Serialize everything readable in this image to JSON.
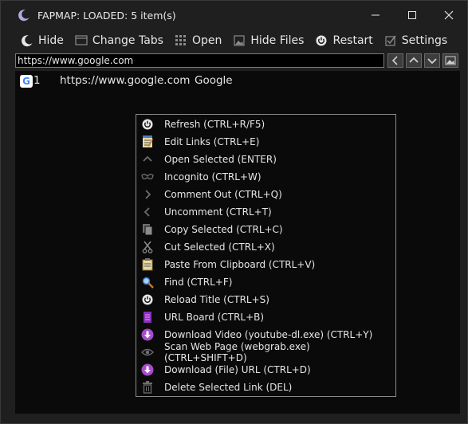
{
  "window": {
    "title": "FAPMAP: LOADED: 5 item(s)",
    "icon": "moon-icon",
    "controls": [
      "minimize-icon",
      "maximize-icon",
      "close-icon"
    ]
  },
  "menu": [
    {
      "label": "Hide",
      "icon": "moon-icon"
    },
    {
      "label": "Change Tabs",
      "icon": "window-icon"
    },
    {
      "label": "Open",
      "icon": "grid-icon"
    },
    {
      "label": "Hide Files",
      "icon": "image-icon"
    },
    {
      "label": "Restart",
      "icon": "power-icon"
    },
    {
      "label": "Settings",
      "icon": "checkbox-icon"
    }
  ],
  "url_bar": {
    "value": "https://www.google.com"
  },
  "nav_buttons": [
    "chevron-left-icon",
    "chevron-up-icon",
    "chevron-down-icon",
    "image-icon"
  ],
  "list": [
    {
      "num": "1",
      "url": "https://www.google.com",
      "title": "Google",
      "favicon": "G"
    }
  ],
  "context_menu": [
    {
      "label": "Refresh (CTRL+R/F5)",
      "icon": "power-icon"
    },
    {
      "label": "Edit Links (CTRL+E)",
      "icon": "notepad-icon"
    },
    {
      "label": "Open Selected (ENTER)",
      "icon": "chevron-up-icon"
    },
    {
      "label": "Incognito (CTRL+W)",
      "icon": "mask-icon"
    },
    {
      "label": "Comment Out (CTRL+Q)",
      "icon": "chevron-right-icon"
    },
    {
      "label": "Uncomment (CTRL+T)",
      "icon": "chevron-left-icon"
    },
    {
      "label": "Copy Selected (CTRL+C)",
      "icon": "copy-icon"
    },
    {
      "label": "Cut Selected (CTRL+X)",
      "icon": "scissors-icon"
    },
    {
      "label": "Paste From Clipboard (CTRL+V)",
      "icon": "clipboard-icon"
    },
    {
      "label": "Find (CTRL+F)",
      "icon": "magnifier-icon"
    },
    {
      "label": "Reload Title (CTRL+S)",
      "icon": "power-icon"
    },
    {
      "label": "URL Board (CTRL+B)",
      "icon": "board-icon"
    },
    {
      "label": "Download Video (youtube-dl.exe) (CTRL+Y)",
      "icon": "download-icon"
    },
    {
      "label": "Scan Web Page (webgrab.exe) (CTRL+SHIFT+D)",
      "icon": "eye-icon"
    },
    {
      "label": "Download (File) URL (CTRL+D)",
      "icon": "download-icon"
    },
    {
      "label": "Delete Selected Link (DEL)",
      "icon": "trash-icon"
    }
  ],
  "colors": {
    "background": "#1f1f1f",
    "list_background": "#0a0a0a",
    "text": "#e6e6e6",
    "accent_purple": "#a64dcc",
    "icon_grey": "#8c8c8c"
  }
}
